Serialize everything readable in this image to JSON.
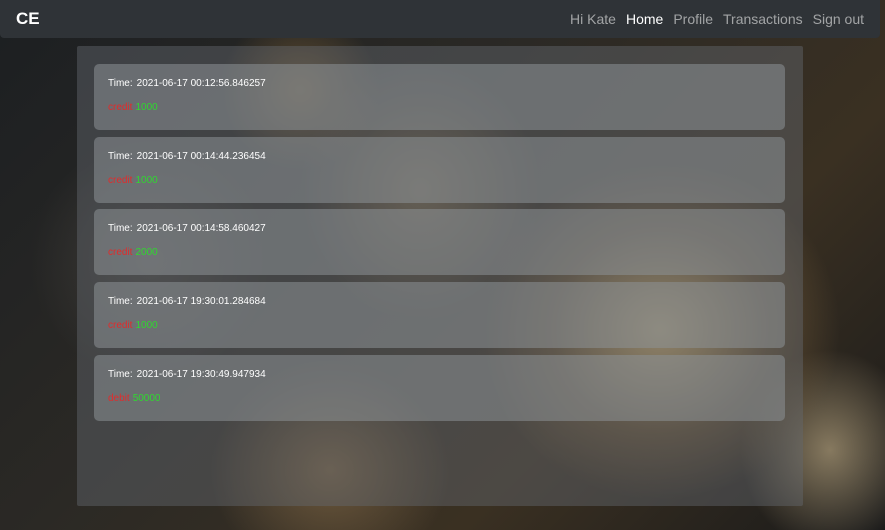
{
  "navbar": {
    "brand": "CE",
    "greeting": "Hi Kate",
    "links": [
      "Home",
      "Profile",
      "Transactions",
      "Sign out"
    ],
    "active": "Home"
  },
  "transactions": [
    {
      "time_label": "Time:",
      "time": "2021-06-17 00:12:56.846257",
      "type": "credit",
      "amount": "1000"
    },
    {
      "time_label": "Time:",
      "time": "2021-06-17 00:14:44.236454",
      "type": "credit",
      "amount": "1000"
    },
    {
      "time_label": "Time:",
      "time": "2021-06-17 00:14:58.460427",
      "type": "credit",
      "amount": "2000"
    },
    {
      "time_label": "Time:",
      "time": "2021-06-17 19:30:01.284684",
      "type": "credit",
      "amount": "1000"
    },
    {
      "time_label": "Time:",
      "time": "2021-06-17 19:30:49.947934",
      "type": "debit",
      "amount": "50000"
    }
  ],
  "colors": {
    "navbar_bg": "#2f3337",
    "type_color": "#e22b2b",
    "amount_color": "#2fd82f"
  }
}
